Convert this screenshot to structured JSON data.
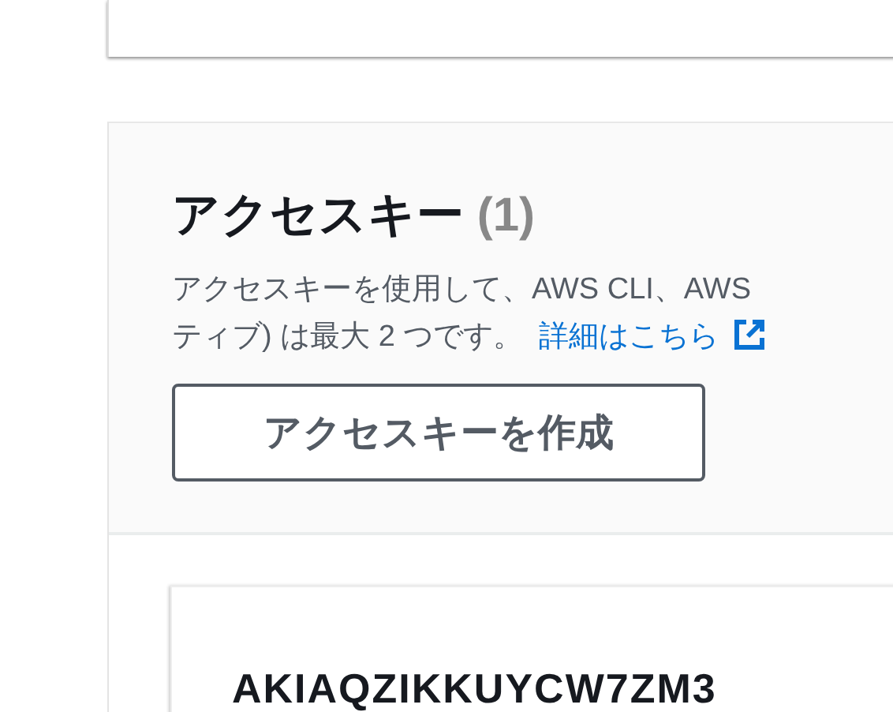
{
  "access_keys": {
    "title": "アクセスキー",
    "count": "(1)",
    "description_lines": [
      "アクセスキーを使用して、AWS CLI、AWS",
      "ティブ) は最大 2 つです。"
    ],
    "link": "詳細はこちら",
    "create_button": "アクセスキーを作成",
    "keys": [
      {
        "id": "AKIAQZIKKUYCW7ZM3"
      }
    ]
  }
}
